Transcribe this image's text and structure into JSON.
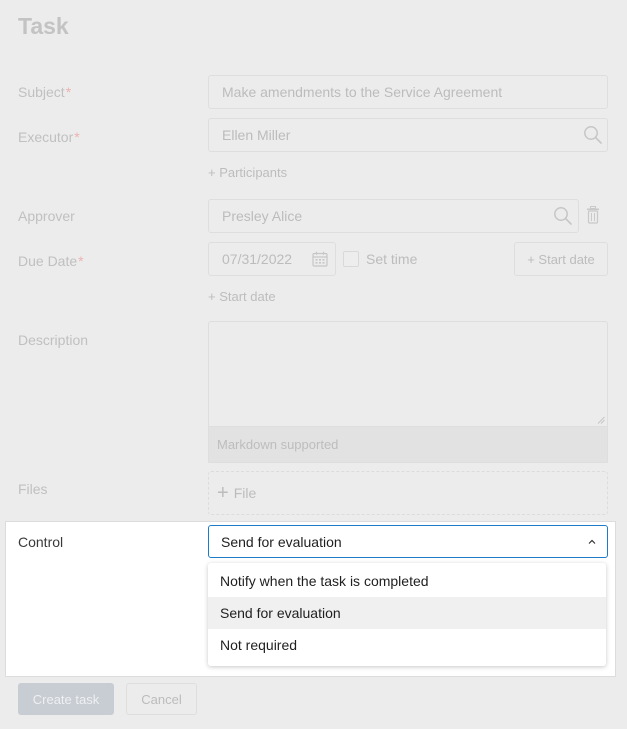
{
  "page": {
    "title": "Task"
  },
  "form": {
    "subject": {
      "label": "Subject",
      "required_mark": "*",
      "value": "Make amendments to the Service Agreement"
    },
    "executor": {
      "label": "Executor",
      "required_mark": "*",
      "value": "Ellen Miller",
      "icon": "search-icon"
    },
    "participants_link": "+ Participants",
    "approver": {
      "label": "Approver",
      "value": "Presley Alice",
      "icon": "search-icon",
      "delete_icon": "trash-icon"
    },
    "due_date": {
      "label": "Due Date",
      "required_mark": "*",
      "value": "07/31/2022",
      "icon": "calendar-icon",
      "set_time_label": "Set time",
      "set_time_checked": false,
      "start_date_button": "+ Start date"
    },
    "start_date_link": "+ Start date",
    "description": {
      "label": "Description",
      "value": "",
      "hint": "Markdown supported"
    },
    "files": {
      "label": "Files",
      "add_label": "File"
    },
    "control": {
      "label": "Control",
      "selected": "Send for evaluation",
      "options": [
        "Notify when the task is completed",
        "Send for evaluation",
        "Not required"
      ],
      "selected_index": 1,
      "accent_color": "#1e7bc7"
    }
  },
  "actions": {
    "create_label": "Create task",
    "cancel_label": "Cancel"
  }
}
